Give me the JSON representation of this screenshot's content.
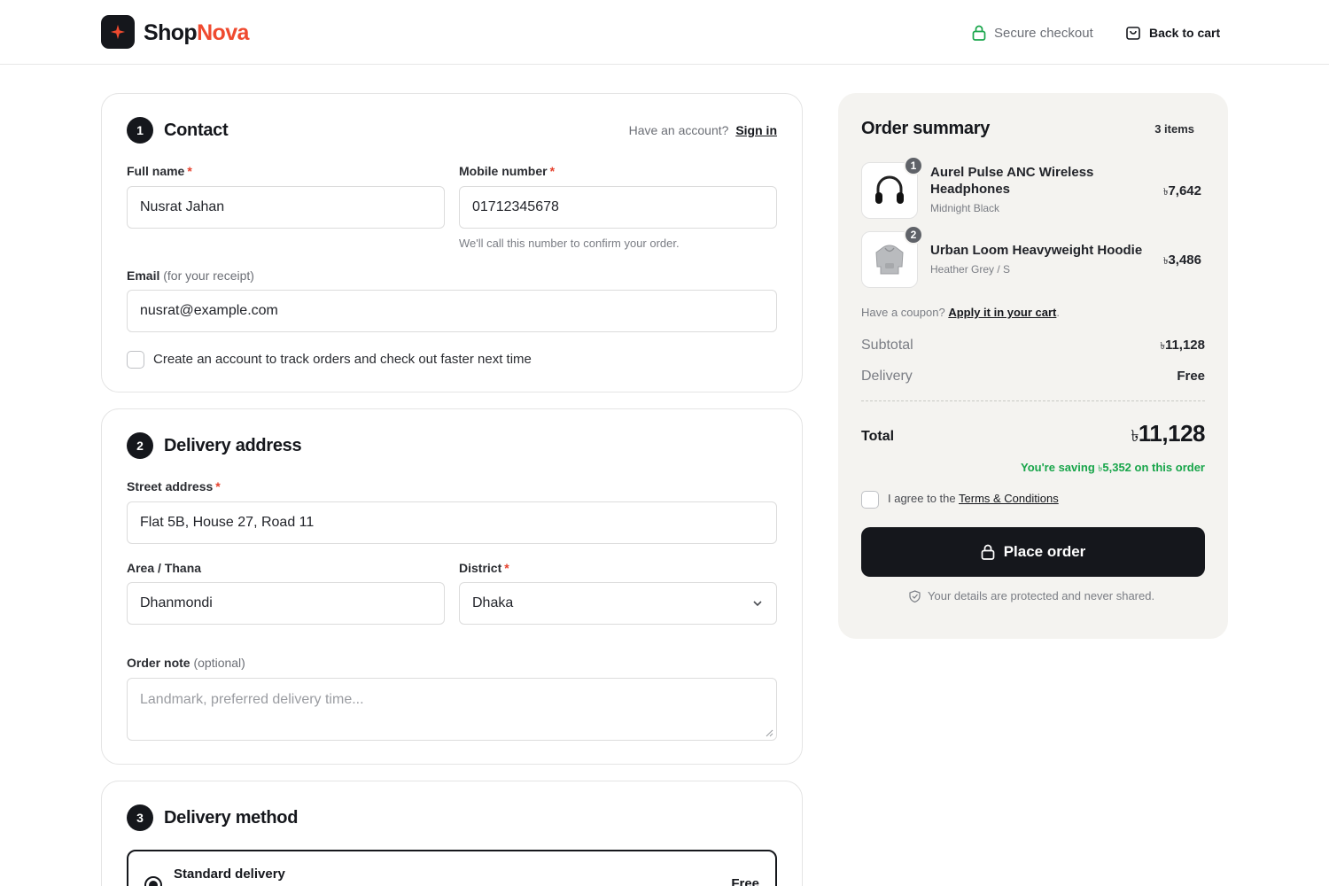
{
  "header": {
    "brand_main": "Shop",
    "brand_accent": "Nova",
    "secure_label": "Secure checkout",
    "back_label": "Back to cart"
  },
  "contact": {
    "step": "1",
    "title": "Contact",
    "account_prompt": "Have an account?",
    "sign_in": "Sign in",
    "full_name_label": "Full name",
    "full_name_value": "Nusrat Jahan",
    "mobile_label": "Mobile number",
    "mobile_value": "01712345678",
    "mobile_hint": "We'll call this number to confirm your order.",
    "email_label": "Email",
    "email_label_suffix": "(for your receipt)",
    "email_value": "nusrat@example.com",
    "create_account_label": "Create an account to track orders and check out faster next time",
    "required_mark": "*"
  },
  "address": {
    "step": "2",
    "title": "Delivery address",
    "street_label": "Street address",
    "street_value": "Flat 5B, House 27, Road 11",
    "area_label": "Area / Thana",
    "area_value": "Dhanmondi",
    "district_label": "District",
    "district_value": "Dhaka",
    "note_label": "Order note",
    "note_label_suffix": "(optional)",
    "note_placeholder": "Landmark, preferred delivery time..."
  },
  "delivery_method": {
    "step": "3",
    "title": "Delivery method",
    "option_label": "Standard delivery",
    "option_price": "Free"
  },
  "summary": {
    "title": "Order summary",
    "item_count": "3 items",
    "currency": "৳",
    "items": [
      {
        "qty": "1",
        "name": "Aurel Pulse ANC Wireless Headphones",
        "variant": "Midnight Black",
        "price": "7,642",
        "icon": "headphones-icon"
      },
      {
        "qty": "2",
        "name": "Urban Loom Heavyweight Hoodie",
        "variant": "Heather Grey / S",
        "price": "3,486",
        "icon": "hoodie-icon"
      }
    ],
    "coupon_prompt": "Have a coupon?",
    "coupon_link": "Apply it in your cart",
    "coupon_period": ".",
    "subtotal_label": "Subtotal",
    "subtotal_value": "11,128",
    "delivery_label": "Delivery",
    "delivery_value": "Free",
    "total_label": "Total",
    "total_value": "11,128",
    "saving_prefix": "You're saving",
    "saving_value": "5,352",
    "saving_suffix": "on this order",
    "terms_prefix": "I agree to the",
    "terms_link": "Terms & Conditions",
    "place_order": "Place order",
    "protected_note": "Your details are protected and never shared."
  },
  "colors": {
    "brand_dark": "#15171c",
    "brand_accent": "#ef4a2f",
    "success": "#18a54a",
    "required": "#e5412d"
  }
}
